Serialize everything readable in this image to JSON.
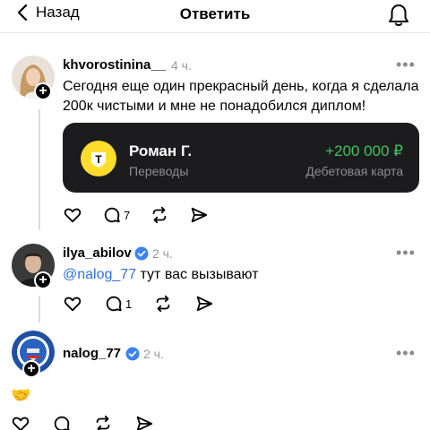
{
  "header": {
    "back_label": "Назад",
    "title": "Ответить"
  },
  "posts": [
    {
      "username": "khvorostinina__",
      "time": "4 ч.",
      "text": "Сегодня еще один прекрасный день, когда я сделала 200к чистыми и мне не понадобился диплом!",
      "card": {
        "logo_letter": "T",
        "name": "Роман Г.",
        "subtitle": "Переводы",
        "amount": "+200 000 ₽",
        "type": "Дебетовая карта"
      },
      "reply_count": "7"
    },
    {
      "username": "ilya_abilov",
      "time": "2 ч.",
      "mention": "@nalog_77",
      "text": " тут вас вызывают",
      "reply_count": "1"
    },
    {
      "username": "nalog_77",
      "time": "2 ч.",
      "text": "🤝"
    }
  ],
  "more_label": "•••",
  "plus_label": "+",
  "colors": {
    "accent_link": "#2f6fde",
    "verified": "#3b82f6",
    "amount_green": "#3fc062",
    "card_bg": "#1c1c1e",
    "logo_yellow": "#ffdd2d"
  }
}
